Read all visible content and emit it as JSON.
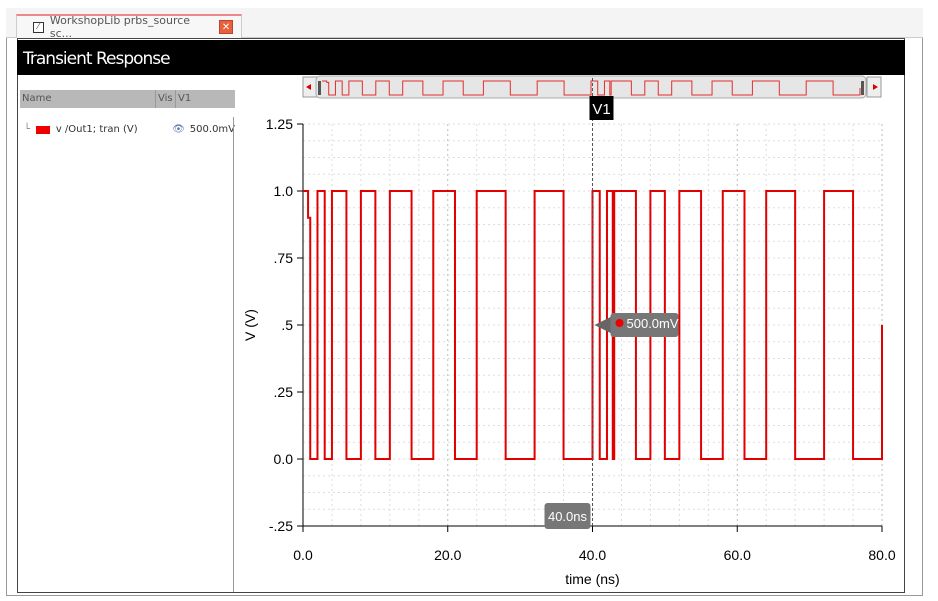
{
  "tab": {
    "label": "WorkshopLib prbs_source sc...",
    "close_icon": "close-icon"
  },
  "title": "Transient Response",
  "legend": {
    "headers": [
      "Name",
      "Vis",
      "V1"
    ],
    "rows": [
      {
        "name": "v /Out1; tran (V)",
        "value": "500.0mV",
        "color": "#e00000"
      }
    ]
  },
  "marker": {
    "label": "V1",
    "x_label": "40.0ns",
    "y_label": "500.0mV"
  },
  "chart_data": {
    "type": "line",
    "xlabel": "time (ns)",
    "ylabel": "V (V)",
    "xlim": [
      0,
      80
    ],
    "ylim": [
      -0.25,
      1.25
    ],
    "xticks": [
      {
        "v": 0,
        "l": "0.0"
      },
      {
        "v": 20,
        "l": "20.0"
      },
      {
        "v": 40,
        "l": "40.0"
      },
      {
        "v": 60,
        "l": "60.0"
      },
      {
        "v": 80,
        "l": "80.0"
      }
    ],
    "yticks": [
      {
        "v": 1.25,
        "l": "1.25"
      },
      {
        "v": 1.0,
        "l": "1.0"
      },
      {
        "v": 0.75,
        "l": ".75"
      },
      {
        "v": 0.5,
        "l": ".5"
      },
      {
        "v": 0.25,
        "l": ".25"
      },
      {
        "v": 0,
        "l": "0.0"
      },
      {
        "v": -0.25,
        "l": "-.25"
      }
    ],
    "grid": true,
    "series": [
      {
        "name": "v /Out1; tran (V)",
        "color": "#e00000",
        "points": [
          [
            0,
            1
          ],
          [
            0.7,
            1
          ],
          [
            0.7,
            0.9
          ],
          [
            1,
            0.9
          ],
          [
            1,
            0
          ],
          [
            2,
            0
          ],
          [
            2,
            1
          ],
          [
            3,
            1
          ],
          [
            3,
            0
          ],
          [
            4,
            0
          ],
          [
            4,
            1
          ],
          [
            6,
            1
          ],
          [
            6,
            0
          ],
          [
            8,
            0
          ],
          [
            8,
            1
          ],
          [
            10,
            1
          ],
          [
            10,
            0
          ],
          [
            12,
            0
          ],
          [
            12,
            1
          ],
          [
            15,
            1
          ],
          [
            15,
            0
          ],
          [
            18,
            0
          ],
          [
            18,
            1
          ],
          [
            21,
            1
          ],
          [
            21,
            0
          ],
          [
            24,
            0
          ],
          [
            24,
            1
          ],
          [
            28,
            1
          ],
          [
            28,
            0
          ],
          [
            32,
            0
          ],
          [
            32,
            1
          ],
          [
            36,
            1
          ],
          [
            36,
            0
          ],
          [
            40,
            0
          ],
          [
            40,
            1
          ],
          [
            41,
            1
          ],
          [
            41,
            0
          ],
          [
            42,
            0
          ],
          [
            42,
            1
          ],
          [
            42.8,
            1
          ],
          [
            42.8,
            0
          ],
          [
            43,
            0
          ],
          [
            43,
            1
          ],
          [
            46,
            1
          ],
          [
            46,
            0
          ],
          [
            48,
            0
          ],
          [
            48,
            1
          ],
          [
            50,
            1
          ],
          [
            50,
            0
          ],
          [
            52,
            0
          ],
          [
            52,
            1
          ],
          [
            55,
            1
          ],
          [
            55,
            0
          ],
          [
            58,
            0
          ],
          [
            58,
            1
          ],
          [
            61,
            1
          ],
          [
            61,
            0
          ],
          [
            64,
            0
          ],
          [
            64,
            1
          ],
          [
            68,
            1
          ],
          [
            68,
            0
          ],
          [
            72,
            0
          ],
          [
            72,
            1
          ],
          [
            76,
            1
          ],
          [
            76,
            0
          ],
          [
            80,
            0
          ],
          [
            80,
            0.3
          ],
          [
            80,
            0.5
          ]
        ]
      }
    ],
    "marker_x": 40,
    "marker_y": 0.5
  }
}
